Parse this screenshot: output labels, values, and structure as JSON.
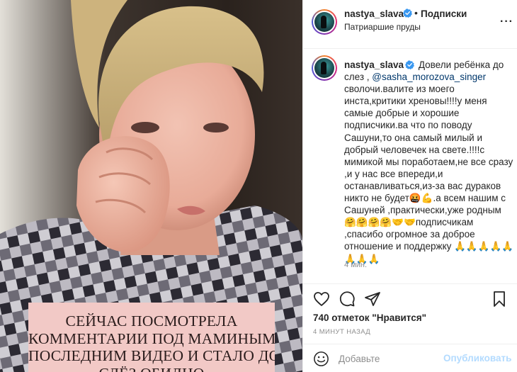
{
  "media": {
    "overlay_lines": [
      "СЕЙЧАС ПОСМОТРЕЛА",
      "КОММЕНТАРИИ ПОД МАМИНЫМ",
      "ПОСЛЕДНИМ ВИДЕО И СТАЛО ДО",
      "СЛЁЗ ОБИДНО"
    ]
  },
  "header": {
    "username": "nastya_slava",
    "separator": "•",
    "follow_label": "Подписки",
    "location": "Патриаршие пруды",
    "more_icon": "more-horizontal-icon"
  },
  "comment": {
    "username": "nastya_slava",
    "text_1": "Довели ребёнка до слез ,",
    "mention": "@sasha_morozova_singer",
    "text_2": "сволочи.валите из моего инста,критики хреновы!!!!у меня самые добрые и хорошие подписчики.ва что по поводу Сашуни,то она самый милый и добрый человечек на свете.!!!!с мимикой мы поработаем,не все сразу ,и у нас все впереди,и останавливаться,из-за вас дураков никто не будет🤬💪.а всем нашим с Сашуней ,практически,уже родным 🤗🤗🤗🤗🤝🤝подписчикам ,спасибо огромное за доброе отношение и поддержку 🙏🙏🙏🙏🙏🙏🙏🙏",
    "time": "4 мин."
  },
  "actions": {
    "like_icon": "heart-icon",
    "comment_icon": "comment-icon",
    "share_icon": "share-icon",
    "save_icon": "bookmark-icon"
  },
  "likes_text": "740 отметок \"Нравится\"",
  "timestamp": "4 МИНУТ НАЗАД",
  "add_comment": {
    "placeholder": "Добавьте",
    "publish_label": "Опубликовать"
  },
  "colors": {
    "accent_link": "#00376b",
    "verified": "#3897f0",
    "publish_disabled": "#b3dbff",
    "overlay_bg": "#f2c9c6"
  }
}
